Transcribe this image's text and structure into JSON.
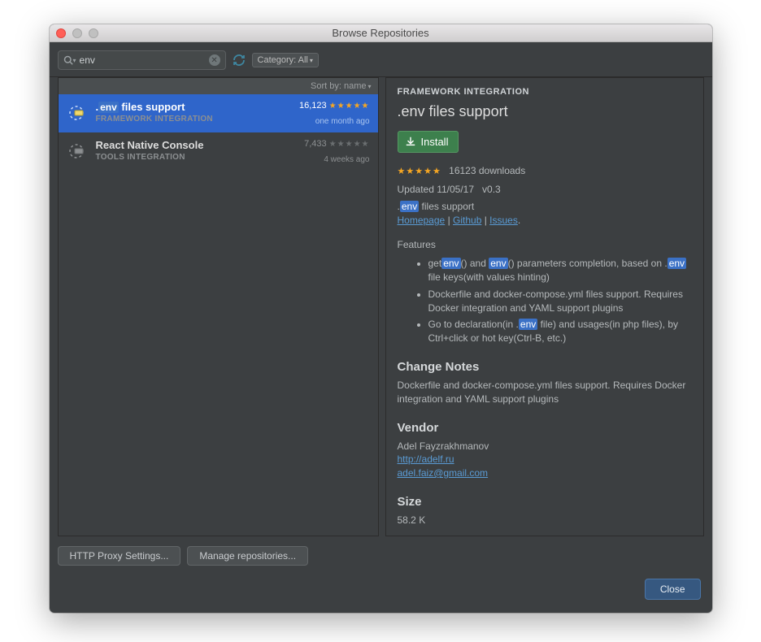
{
  "window": {
    "title": "Browse Repositories"
  },
  "toolbar": {
    "search_value": "env",
    "category_label": "Category: All"
  },
  "sort": {
    "label": "Sort by: name"
  },
  "plugins": [
    {
      "name_pre": ".",
      "name_tag": "env",
      "name_post": " files support",
      "category": "FRAMEWORK INTEGRATION",
      "downloads": "16,123",
      "ago": "one month ago",
      "selected": true,
      "stars_full": true
    },
    {
      "name_pre": "React Native Console",
      "name_tag": "",
      "name_post": "",
      "category": "TOOLS INTEGRATION",
      "downloads": "7,433",
      "ago": "4 weeks ago",
      "selected": false,
      "stars_full": false
    }
  ],
  "detail": {
    "breadcrumb": "FRAMEWORK INTEGRATION",
    "title": ".env files support",
    "install_label": "Install",
    "downloads_text": "16123 downloads",
    "updated_label": "Updated 11/05/17",
    "version": "v0.3",
    "short_pre": ".",
    "short_tag": "env",
    "short_post": " files support",
    "links": {
      "homepage": "Homepage",
      "github": "Github",
      "issues": "Issues"
    },
    "features_heading": "Features",
    "features": {
      "f1a": "get",
      "f1b": "() and ",
      "f1c": "() parameters completion, based on .",
      "f1d": " file keys(with values hinting)",
      "f2": "Dockerfile and docker-compose.yml files support. Requires Docker integration and YAML support plugins",
      "f3a": "Go to declaration(in .",
      "f3b": " file) and usages(in php files), by Ctrl+click or hot key(Ctrl-B, etc.)"
    },
    "change_notes_h": "Change Notes",
    "change_notes": "Dockerfile and docker-compose.yml files support. Requires Docker integration and YAML support plugins",
    "vendor_h": "Vendor",
    "vendor_name": "Adel Fayzrakhmanov",
    "vendor_url": "http://adelf.ru",
    "vendor_email": "adel.faiz@gmail.com",
    "size_h": "Size",
    "size": "58.2 K"
  },
  "footer_buttons": {
    "proxy": "HTTP Proxy Settings...",
    "manage": "Manage repositories...",
    "close": "Close"
  }
}
